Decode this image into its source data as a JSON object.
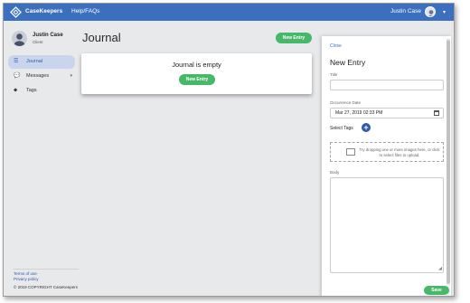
{
  "header": {
    "brand": "CaseKeepers",
    "help_link": "Help/FAQs",
    "user_name": "Justin Case",
    "caret": "▾"
  },
  "sidebar": {
    "user_name": "Justin Case",
    "user_role": "Client",
    "items": [
      {
        "label": "Journal",
        "icon": "journal-icon",
        "active": true
      },
      {
        "label": "Messages",
        "icon": "chat-icon",
        "expandable": true
      },
      {
        "label": "Tags",
        "icon": "tag-icon"
      }
    ],
    "footer_links": [
      "Terms of use",
      "Privacy policy"
    ],
    "copyright": "© 2019 COPYRIGHT CaseKeepers"
  },
  "main": {
    "title": "Journal",
    "new_entry_label": "New Entry",
    "empty_message": "Journal is empty",
    "card_button_label": "New Entry"
  },
  "panel": {
    "close_label": "Close",
    "title": "New Entry",
    "title_label": "Title",
    "title_value": "",
    "date_label": "Occurrence Date",
    "date_value": "Mar 27, 2019 02:33 PM",
    "tags_label": "Select Tags",
    "add_tag_symbol": "+",
    "dropzone_text": "Try dropping one or more images here, or click to select files to upload.",
    "body_label": "Body",
    "body_value": "",
    "save_label": "Save"
  },
  "colors": {
    "topbar": "#3d6fbf",
    "accent_green": "#47b86a",
    "link_blue": "#2d59a8"
  }
}
